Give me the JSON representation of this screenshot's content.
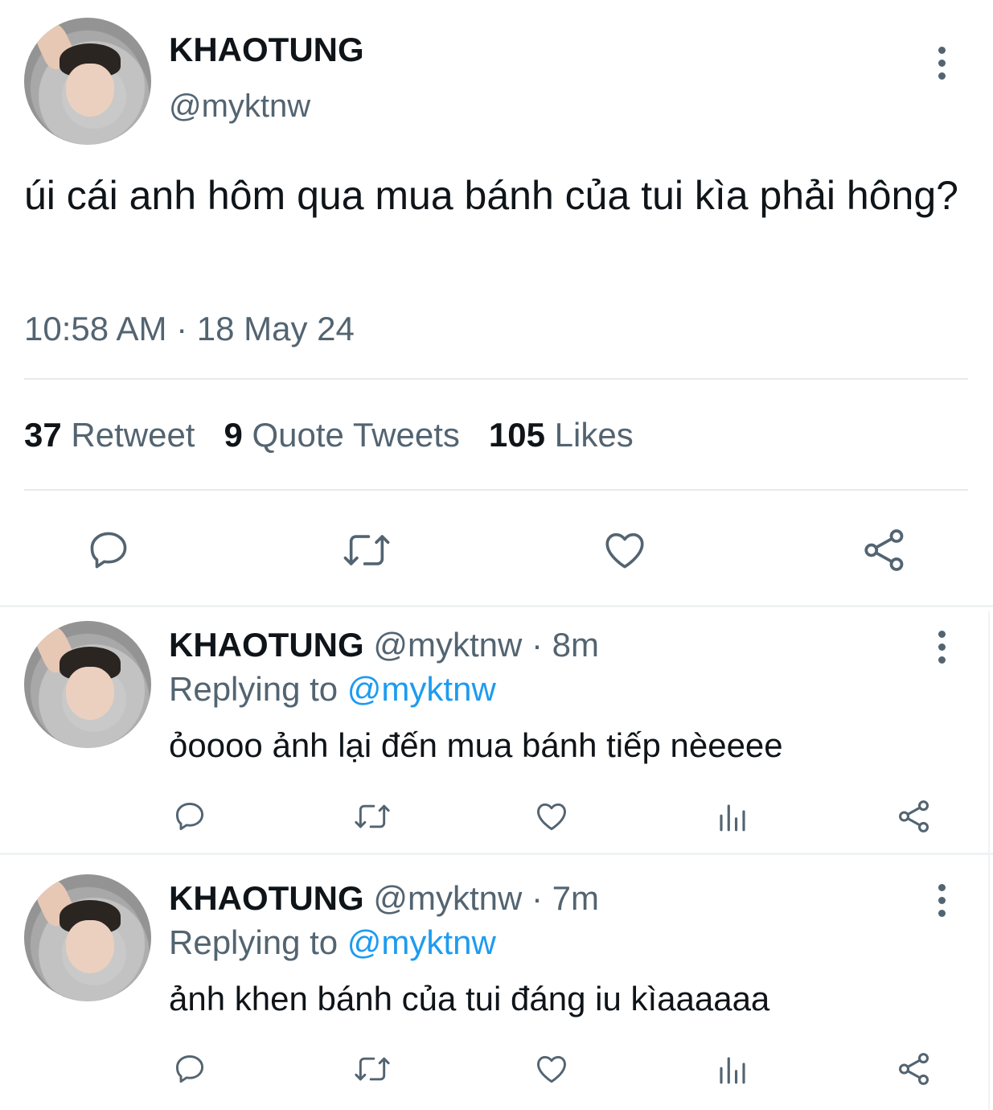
{
  "main_tweet": {
    "display_name": "KHAOTUNG",
    "handle": "@myktnw",
    "text": "úi cái anh hôm qua mua bánh của tui kìa phải hông?",
    "timestamp": "10:58 AM · 18 May 24",
    "stats": {
      "retweets_count": "37",
      "retweets_label": "Retweet",
      "quotes_count": "9",
      "quotes_label": "Quote Tweets",
      "likes_count": "105",
      "likes_label": "Likes"
    },
    "actions": [
      "reply-icon",
      "retweet-icon",
      "heart-icon",
      "share-icon"
    ]
  },
  "replies": [
    {
      "display_name": "KHAOTUNG",
      "handle_time": "@myktnw · 8m",
      "replying_prefix": "Replying to",
      "replying_mention": "@myktnw",
      "text": "ỏoooo ảnh lại đến mua bánh tiếp nèeeee",
      "actions": [
        "reply-icon",
        "retweet-icon",
        "heart-icon",
        "analytics-icon",
        "share-icon"
      ]
    },
    {
      "display_name": "KHAOTUNG",
      "handle_time": "@myktnw · 7m",
      "replying_prefix": "Replying to",
      "replying_mention": "@myktnw",
      "text": "ảnh khen bánh của tui đáng iu kìaaaaaa",
      "actions": [
        "reply-icon",
        "retweet-icon",
        "heart-icon",
        "analytics-icon",
        "share-icon"
      ]
    }
  ],
  "colors": {
    "text_primary": "#0f1419",
    "text_secondary": "#536471",
    "mention": "#1d9bf0",
    "divider": "#e7e9eb"
  }
}
